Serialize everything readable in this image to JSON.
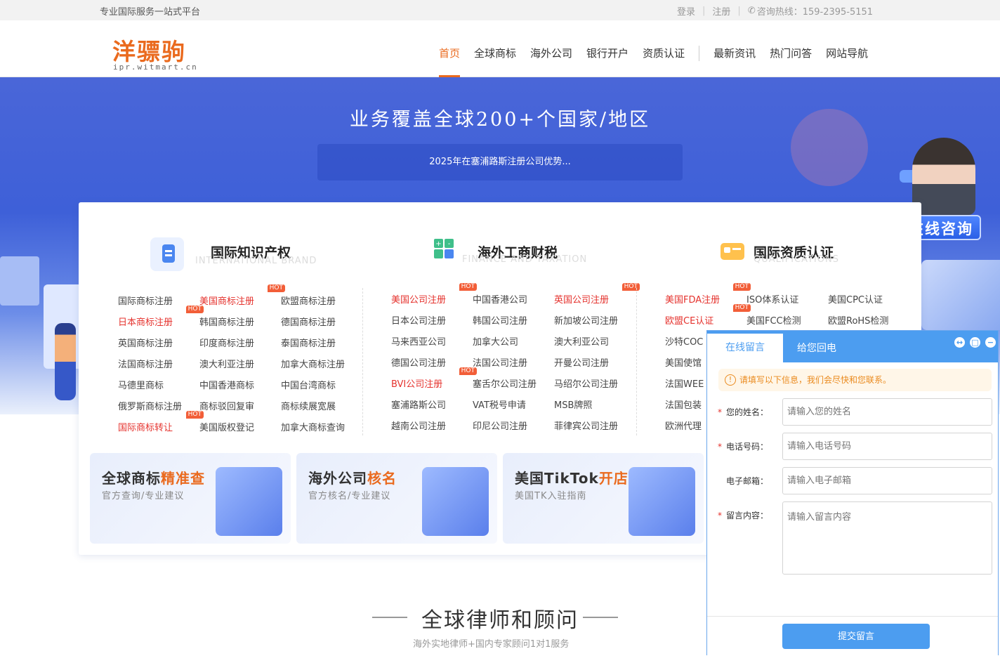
{
  "topbar": {
    "slogan": "专业国际服务一站式平台",
    "login": "登录",
    "register": "注册",
    "hotline": "咨询热线：159-2395-5151"
  },
  "header": {
    "logo_cn": "洋骠驹",
    "logo_en": "ipr.witmart.cn",
    "nav": [
      "首页",
      "全球商标",
      "海外公司",
      "银行开户",
      "资质认证",
      "最新资讯",
      "热门问答",
      "网站导航"
    ]
  },
  "hero": {
    "title": "业务覆盖全球200+个国家/地区",
    "news": "2025年在塞浦路斯注册公司优势..."
  },
  "consult": {
    "label": "在线咨询"
  },
  "columns": [
    {
      "title": "国际知识产权",
      "subtitle": "INTERNATIONAL BRAND",
      "items": [
        "国际商标注册",
        "美国商标注册",
        "欧盟商标注册",
        "日本商标注册",
        "韩国商标注册",
        "德国商标注册",
        "英国商标注册",
        "印度商标注册",
        "泰国商标注册",
        "法国商标注册",
        "澳大利亚注册",
        "加拿大商标注册",
        "马德里商标",
        "中国香港商标",
        "中国台湾商标",
        "俄罗斯商标注册",
        "商标驳回复审",
        "商标续展宽展",
        "国际商标转让",
        "美国版权登记",
        "加拿大商标查询"
      ]
    },
    {
      "title": "海外工商财税",
      "subtitle": "FINANCE AND TAXATION",
      "items": [
        "美国公司注册",
        "中国香港公司",
        "英国公司注册",
        "日本公司注册",
        "韩国公司注册",
        "新加坡公司注册",
        "马来西亚公司",
        "加拿大公司",
        "澳大利亚公司",
        "德国公司注册",
        "法国公司注册",
        "开曼公司注册",
        "BVI公司注册",
        "塞舌尔公司注册",
        "马绍尔公司注册",
        "塞浦路斯公司",
        "VAT税号申请",
        "MSB牌照",
        "越南公司注册",
        "印尼公司注册",
        "菲律宾公司注册"
      ]
    },
    {
      "title": "国际资质认证",
      "subtitle": "QUALIFICATIONS",
      "items": [
        "美国FDA注册",
        "ISO体系认证",
        "美国CPC认证",
        "欧盟CE认证",
        "美国FCC检测",
        "欧盟RoHS检测",
        "沙特COC",
        "美国使馆",
        "法国WEE",
        "法国包装",
        "欧洲代理"
      ]
    }
  ],
  "hot_label": "HOT",
  "promos": [
    {
      "title": "全球商标",
      "accent": "精准查",
      "sub": "官方查询/专业建议"
    },
    {
      "title": "海外公司",
      "accent": "核名",
      "sub": "官方核名/专业建议"
    },
    {
      "title": "美国TikTok",
      "accent": "开店",
      "sub": "美国TK入驻指南"
    }
  ],
  "section2": {
    "title": "全球律师和顾问",
    "sub": "海外实地律师+国内专家顾问1对1服务"
  },
  "chat": {
    "tab_leave": "在线留言",
    "tab_call": "给您回电",
    "notice": "请填写以下信息，我们会尽快和您联系。",
    "fields": [
      {
        "label": "您的姓名：",
        "placeholder": "请输入您的姓名",
        "required": true
      },
      {
        "label": "电话号码：",
        "placeholder": "请输入电话号码",
        "required": true
      },
      {
        "label": "电子邮箱：",
        "placeholder": "请输入电子邮箱",
        "required": false
      },
      {
        "label": "留言内容：",
        "placeholder": "请输入留言内容",
        "required": true
      }
    ],
    "submit": "提交留言"
  },
  "colors": {
    "brand": "#ea6a1e",
    "primary": "#4c9df0",
    "hot": "#f25e38",
    "red_link": "#e5322d"
  }
}
